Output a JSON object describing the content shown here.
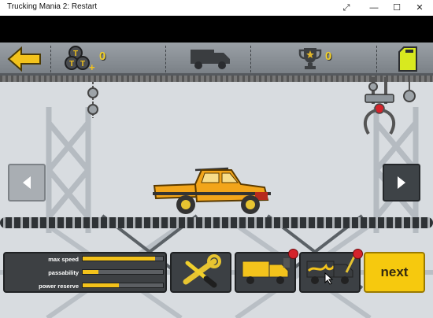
{
  "window": {
    "title": "Trucking Mania 2: Restart",
    "controls": [
      "⤢",
      "—",
      "☐",
      "✕"
    ]
  },
  "hud": {
    "coins_count": "0",
    "trophy_count": "0"
  },
  "stats": {
    "items": [
      {
        "label": "max speed",
        "value": 0.9
      },
      {
        "label": "passability",
        "value": 0.2
      },
      {
        "label": "power reserve",
        "value": 0.45
      }
    ]
  },
  "buttons": {
    "next_label": "next"
  },
  "colors": {
    "accent_yellow": "#f6c90e",
    "hud_grey": "#8a9096",
    "badge_red": "#d4232b",
    "truck_orange": "#f2a51a"
  },
  "icons": [
    "back-arrow-icon",
    "coins-icon",
    "truck-silhouette-icon",
    "trophy-icon",
    "fuel-can-icon",
    "wrench-screwdriver-icon",
    "truck-paint-icon",
    "flame-decal-icon",
    "left-arrow-icon",
    "right-arrow-icon"
  ]
}
